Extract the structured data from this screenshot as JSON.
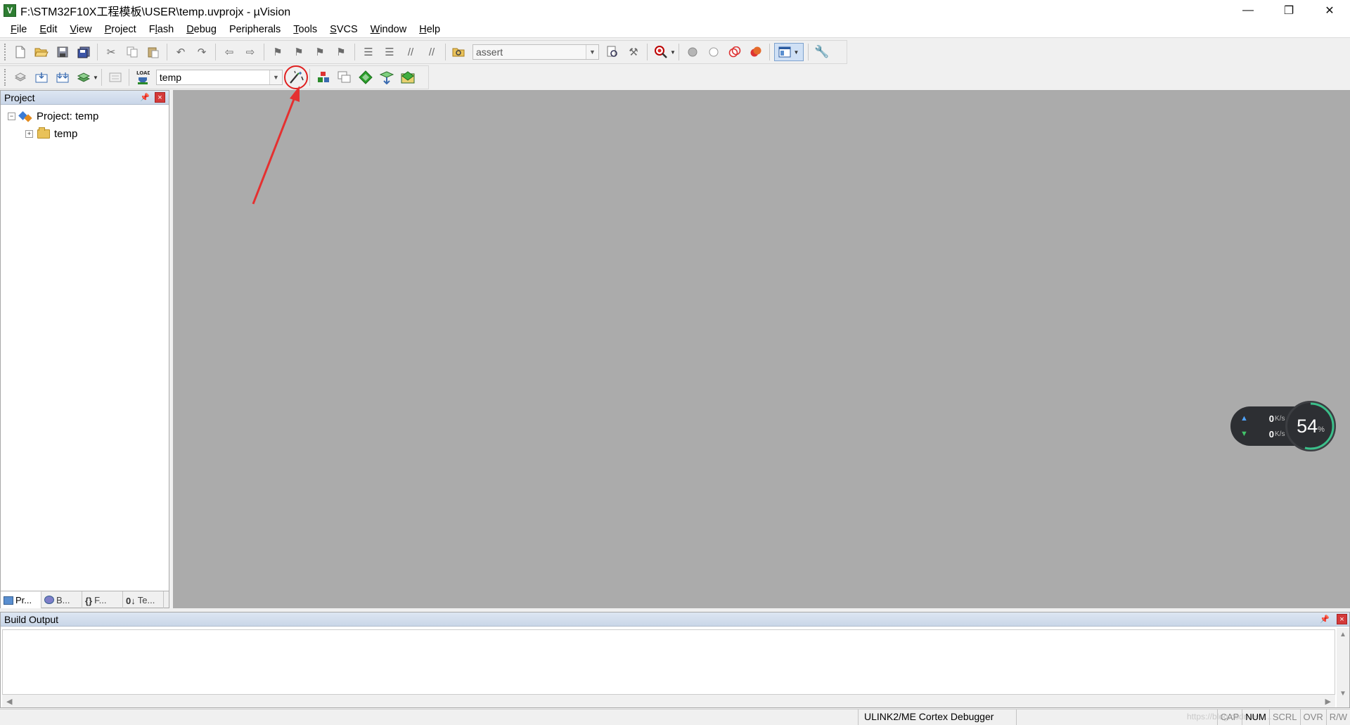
{
  "window": {
    "title": "F:\\STM32F10X工程模板\\USER\\temp.uvprojx - µVision",
    "app_icon_letter": "V",
    "minimize": "—",
    "restore": "❐",
    "close": "✕"
  },
  "menu": [
    {
      "label": "File",
      "key": "F",
      "rest": "ile"
    },
    {
      "label": "Edit",
      "key": "E",
      "rest": "dit"
    },
    {
      "label": "View",
      "key": "V",
      "rest": "iew"
    },
    {
      "label": "Project",
      "key": "P",
      "rest": "roject"
    },
    {
      "label": "Flash",
      "key": "l",
      "pre": "F",
      "rest": "ash"
    },
    {
      "label": "Debug",
      "key": "D",
      "rest": "ebug"
    },
    {
      "label": "Peripherals",
      "key": "k",
      "pre": "Peripherals"
    },
    {
      "label": "Tools",
      "key": "T",
      "rest": "ools"
    },
    {
      "label": "SVCS",
      "key": "S",
      "rest": "VCS"
    },
    {
      "label": "Window",
      "key": "W",
      "rest": "indow"
    },
    {
      "label": "Help",
      "key": "H",
      "rest": "elp"
    }
  ],
  "toolbar": {
    "find_value": "assert",
    "target_value": "temp",
    "load_label": "LOAD"
  },
  "project_panel": {
    "title": "Project",
    "pin": "📌",
    "close": "×",
    "tree": {
      "root_label": "Project: temp",
      "root_expander": "−",
      "child_label": "temp",
      "child_expander": "+"
    },
    "tabs": [
      {
        "label": "Pr..."
      },
      {
        "label": "B..."
      },
      {
        "label": "F...",
        "glyph": "{}"
      },
      {
        "label": "Te...",
        "glyph": "0↓"
      }
    ]
  },
  "net_widget": {
    "upload_value": "0",
    "upload_unit": "K/s",
    "download_value": "0",
    "download_unit": "K/s",
    "cpu_value": "54",
    "cpu_unit": "%",
    "cpu_fraction": 0.54
  },
  "build_output": {
    "title": "Build Output",
    "pin": "📌",
    "close": "×"
  },
  "statusbar": {
    "debugger": "ULINK2/ME Cortex Debugger",
    "watermark": "https://blog.csdn.net/...",
    "keys": [
      {
        "label": "CAP",
        "on": false
      },
      {
        "label": "NUM",
        "on": true
      },
      {
        "label": "SCRL",
        "on": false
      },
      {
        "label": "OVR",
        "on": false
      },
      {
        "label": "R/W",
        "on": false
      }
    ]
  },
  "colors": {
    "editor_bg": "#ababab",
    "annotation_red": "#e02020",
    "panel_head": "#d3deed"
  }
}
